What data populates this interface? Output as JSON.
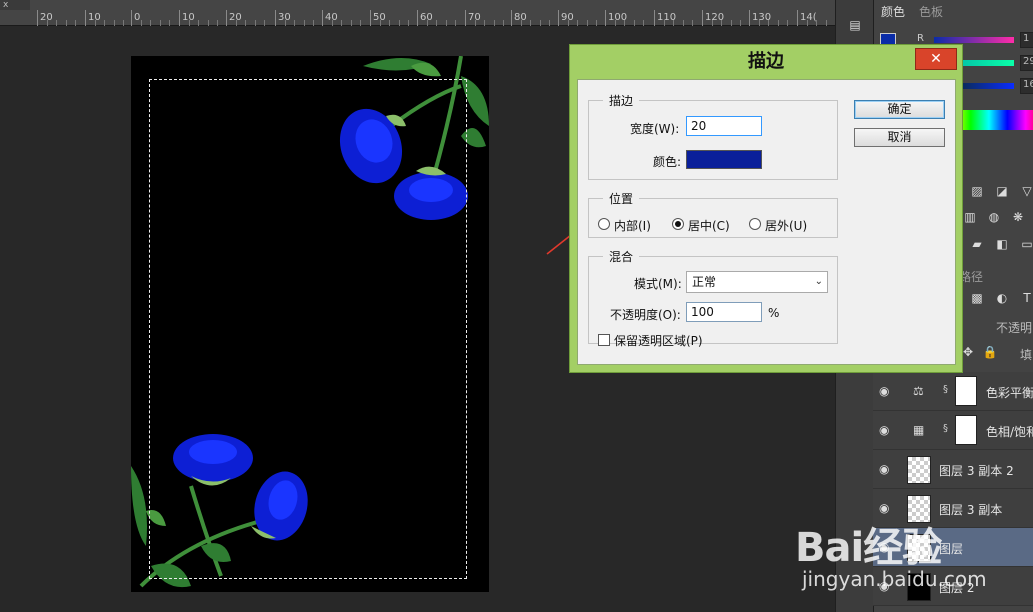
{
  "ruler": {
    "tab": "x",
    "labels": [
      "20",
      "10",
      "0",
      "10",
      "20",
      "30",
      "40",
      "50",
      "60",
      "70",
      "80",
      "90",
      "100",
      "110",
      "120",
      "130",
      "14("
    ]
  },
  "panel": {
    "tab_color": "颜色",
    "tab_swatches": "色板",
    "r_label": "R",
    "values": [
      "1",
      "29",
      "16"
    ],
    "paths_tab": "路径",
    "opacity_label": "不透明",
    "fill_label": "填",
    "foreground_color": "#0a2ca8"
  },
  "layers": [
    {
      "name": "色彩平衡",
      "type": "adjust",
      "icon": "scale-icon"
    },
    {
      "name": "色相/饱和",
      "type": "adjust",
      "icon": "hue-icon"
    },
    {
      "name": "图层 3 副本 2",
      "type": "pixel"
    },
    {
      "name": "图层 3 副本",
      "type": "pixel"
    },
    {
      "name": "图层",
      "type": "pixel",
      "selected": true
    },
    {
      "name": "图层 2",
      "type": "black"
    }
  ],
  "dialog": {
    "title": "描边",
    "close": "✕",
    "stroke_group": "描边",
    "width_label": "宽度(W):",
    "width_value": "20",
    "color_label": "颜色:",
    "stroke_color": "#0a1f9a",
    "position_group": "位置",
    "inside": "内部(I)",
    "center": "居中(C)",
    "outside": "居外(U)",
    "blend_group": "混合",
    "mode_label": "模式(M):",
    "mode_value": "正常",
    "opacity_label": "不透明度(O):",
    "opacity_value": "100",
    "percent": "%",
    "preserve_label": "保留透明区域(P)",
    "ok": "确定",
    "cancel": "取消"
  },
  "watermark": {
    "logo": "Bai经验",
    "url": "jingyan.baidu.com"
  }
}
